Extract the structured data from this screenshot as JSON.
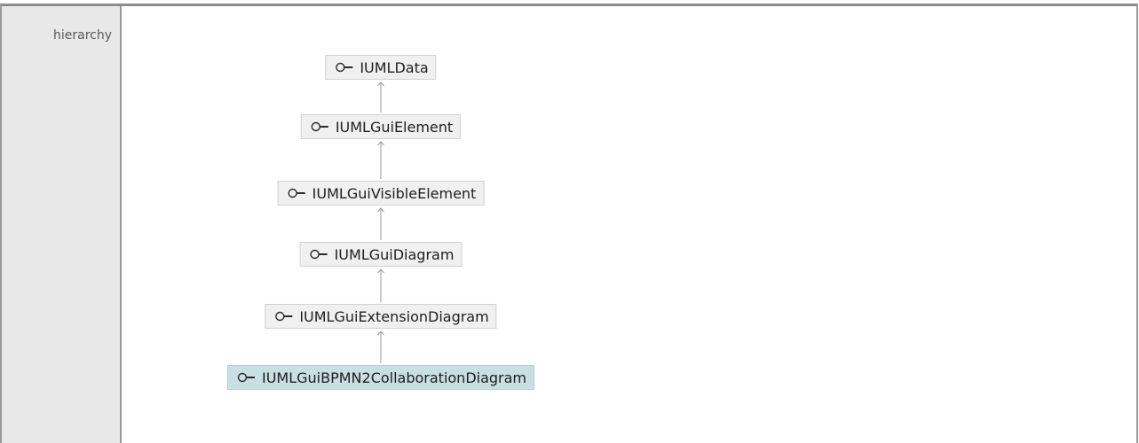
{
  "row_label": "hierarchy",
  "hierarchy": [
    {
      "name": "IUMLData",
      "current": false
    },
    {
      "name": "IUMLGuiElement",
      "current": false
    },
    {
      "name": "IUMLGuiVisibleElement",
      "current": false
    },
    {
      "name": "IUMLGuiDiagram",
      "current": false
    },
    {
      "name": "IUMLGuiExtensionDiagram",
      "current": false
    },
    {
      "name": "IUMLGuiBPMN2CollaborationDiagram",
      "current": true
    }
  ],
  "colors": {
    "node_bg": "#f0f0f0",
    "node_current_bg": "#c8dfe3",
    "arrow": "#9a9a9a"
  },
  "icons": {
    "node": "interface-lollipop-icon",
    "connector": "inheritance-arrow-icon"
  }
}
